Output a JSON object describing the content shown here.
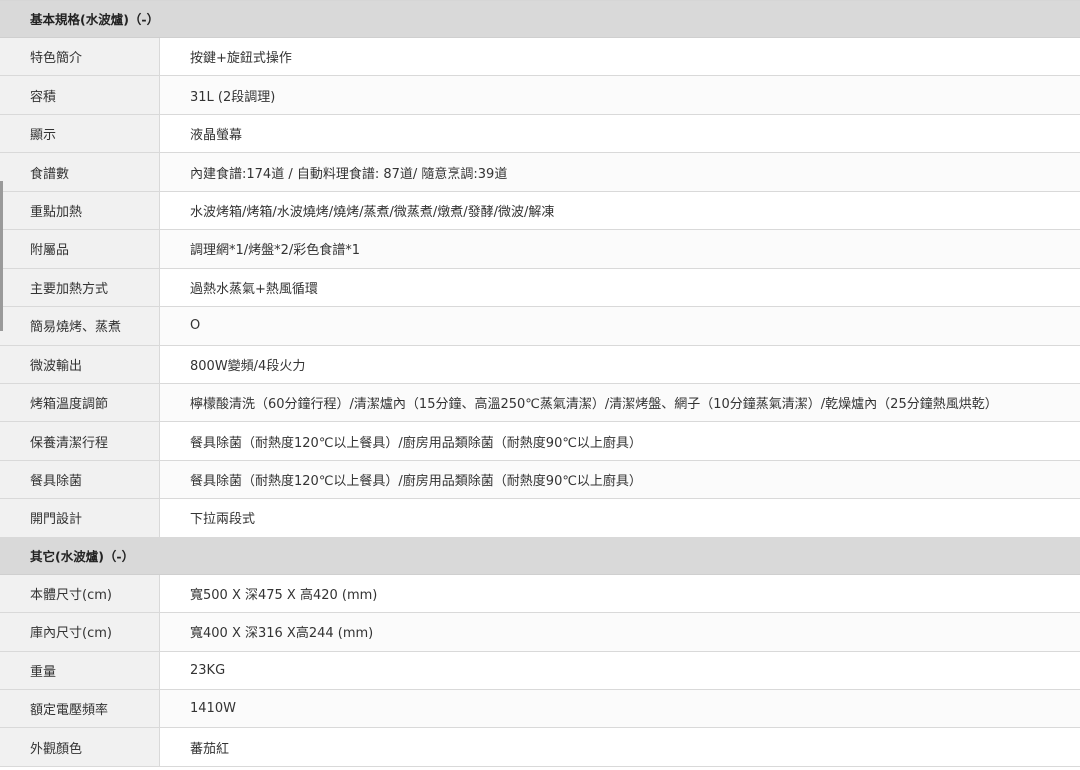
{
  "sections": [
    {
      "title": "基本規格(水波爐)（-）",
      "rows": [
        {
          "label": "特色簡介",
          "value": "按鍵+旋鈕式操作"
        },
        {
          "label": "容積",
          "value": "31L (2段調理)"
        },
        {
          "label": "顯示",
          "value": "液晶螢幕"
        },
        {
          "label": "食譜數",
          "value": "內建食譜:174道 / 自動料理食譜: 87道/ 隨意烹調:39道"
        },
        {
          "label": "重點加熱",
          "value": "水波烤箱/烤箱/水波燒烤/燒烤/蒸煮/微蒸煮/燉煮/發酵/微波/解凍"
        },
        {
          "label": "附屬品",
          "value": "調理網*1/烤盤*2/彩色食譜*1"
        },
        {
          "label": "主要加熱方式",
          "value": "過熱水蒸氣+熱風循環"
        },
        {
          "label": "簡易燒烤、蒸煮",
          "value": "O"
        },
        {
          "label": "微波輸出",
          "value": "800W變頻/4段火力"
        },
        {
          "label": "烤箱溫度調節",
          "value": "檸檬酸清洗（60分鐘行程）/清潔爐內（15分鐘、高溫250℃蒸氣清潔）/清潔烤盤、網子（10分鐘蒸氣清潔）/乾燥爐內（25分鐘熱風烘乾）"
        },
        {
          "label": "保養清潔行程",
          "value": "餐具除菌（耐熱度120℃以上餐具）/廚房用品類除菌（耐熱度90℃以上廚具）"
        },
        {
          "label": "餐具除菌",
          "value": "餐具除菌（耐熱度120℃以上餐具）/廚房用品類除菌（耐熱度90℃以上廚具）"
        },
        {
          "label": "開門設計",
          "value": "下拉兩段式"
        }
      ]
    },
    {
      "title": "其它(水波爐)（-）",
      "rows": [
        {
          "label": "本體尺寸(cm)",
          "value": "寬500 X 深475 X 高420 (mm)"
        },
        {
          "label": "庫內尺寸(cm)",
          "value": "寬400 X 深316 X高244 (mm)"
        },
        {
          "label": "重量",
          "value": "23KG"
        },
        {
          "label": "額定電壓頻率",
          "value": "1410W"
        },
        {
          "label": "外觀顏色",
          "value": "蕃茄紅"
        }
      ]
    }
  ]
}
